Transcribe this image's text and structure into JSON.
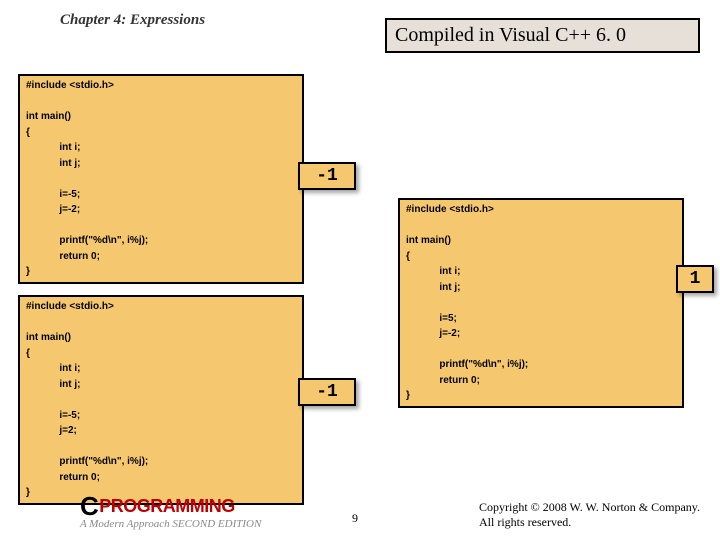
{
  "chapter": "Chapter 4: Expressions",
  "title": "Compiled in Visual C++ 6. 0",
  "code1": "#include <stdio.h>\n\nint main()\n{\n            int i;\n            int j;\n\n            i=-5;\n            j=-2;\n\n            printf(\"%d\\n\", i%j);\n            return 0;\n}",
  "code2": "#include <stdio.h>\n\nint main()\n{\n            int i;\n            int j;\n\n            i=-5;\n            j=2;\n\n            printf(\"%d\\n\", i%j);\n            return 0;\n}",
  "code3": "#include <stdio.h>\n\nint main()\n{\n            int i;\n            int j;\n\n            i=5;\n            j=-2;\n\n            printf(\"%d\\n\", i%j);\n            return 0;\n}",
  "result1": "-1",
  "result2": "-1",
  "result3": "1",
  "page_number": "9",
  "copyright_line1": "Copyright © 2008 W. W. Norton & Company.",
  "copyright_line2": "All rights reserved.",
  "logo_main_c": "C",
  "logo_main_rest": "PROGRAMMING",
  "logo_sub": "A Modern Approach  SECOND EDITION"
}
